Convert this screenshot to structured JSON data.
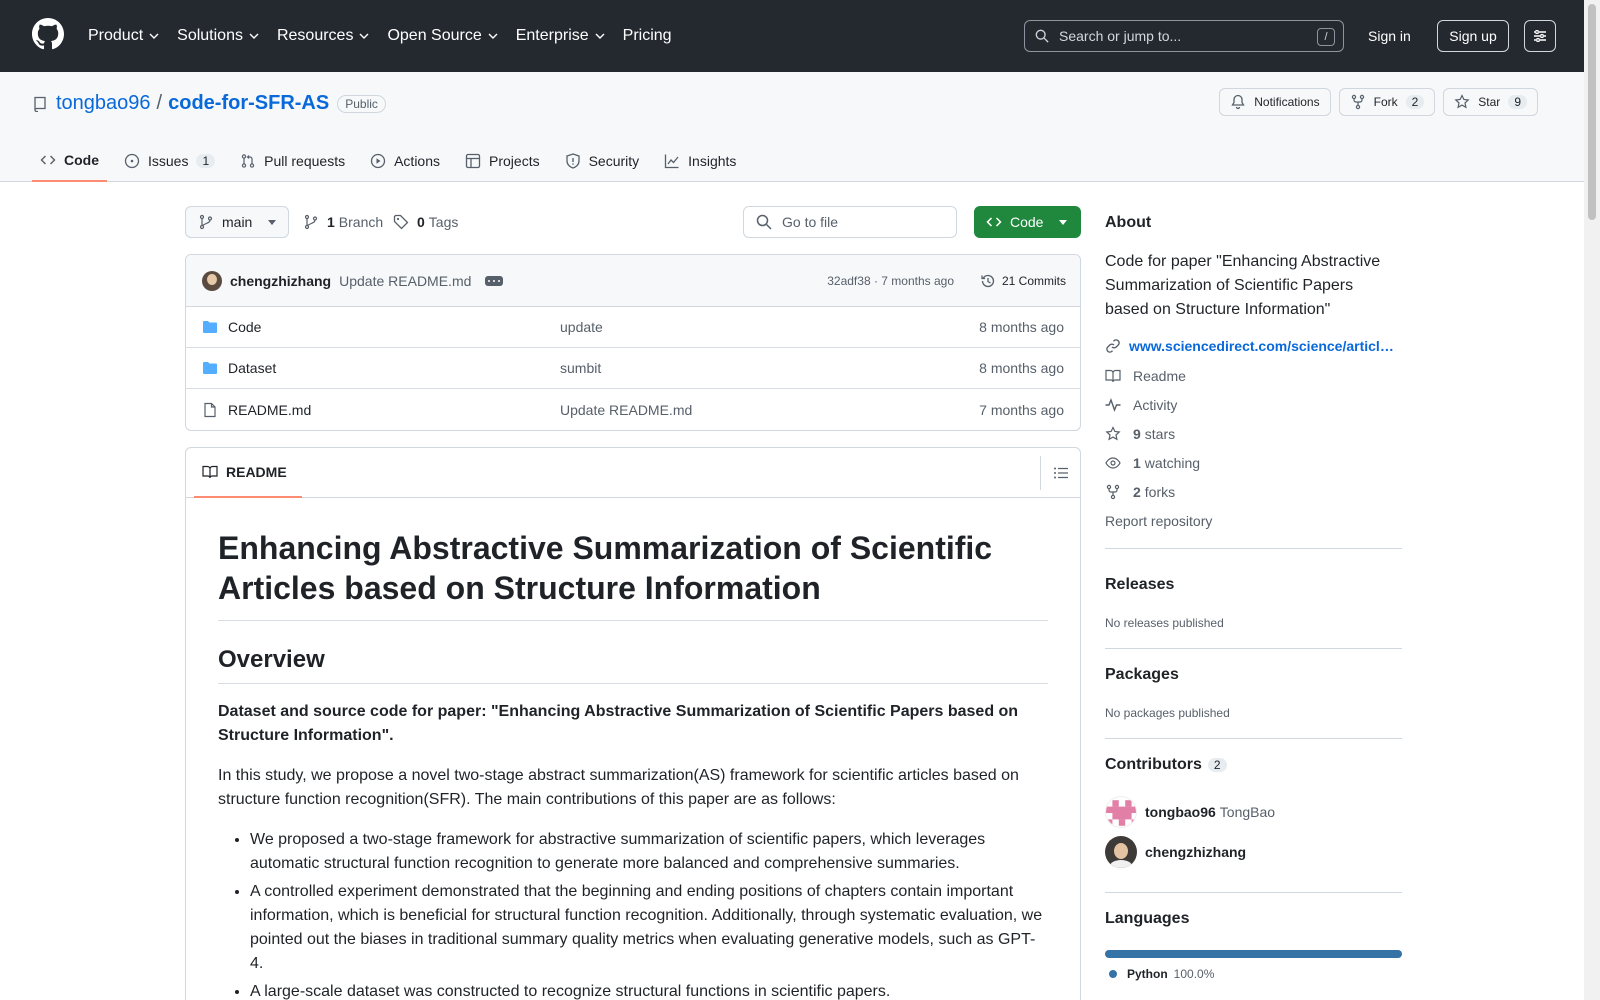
{
  "nav": {
    "items": [
      {
        "label": "Product",
        "has_menu": true
      },
      {
        "label": "Solutions",
        "has_menu": true
      },
      {
        "label": "Resources",
        "has_menu": true
      },
      {
        "label": "Open Source",
        "has_menu": true
      },
      {
        "label": "Enterprise",
        "has_menu": true
      },
      {
        "label": "Pricing",
        "has_menu": false
      }
    ],
    "search_placeholder": "Search or jump to...",
    "search_shortcut": "/",
    "sign_in": "Sign in",
    "sign_up": "Sign up"
  },
  "repo": {
    "owner": "tongbao96",
    "separator": "/",
    "name": "code-for-SFR-AS",
    "visibility": "Public",
    "notifications_label": "Notifications",
    "fork_label": "Fork",
    "fork_count": "2",
    "star_label": "Star",
    "star_count": "9"
  },
  "tabs": [
    {
      "label": "Code",
      "icon": "code-icon",
      "active": true
    },
    {
      "label": "Issues",
      "icon": "issue-icon",
      "count": "1"
    },
    {
      "label": "Pull requests",
      "icon": "pull-request-icon"
    },
    {
      "label": "Actions",
      "icon": "play-icon"
    },
    {
      "label": "Projects",
      "icon": "table-icon"
    },
    {
      "label": "Security",
      "icon": "shield-icon"
    },
    {
      "label": "Insights",
      "icon": "graph-icon"
    }
  ],
  "toolbar": {
    "branch": "main",
    "branch_count": "1",
    "branch_label": "Branch",
    "tag_count": "0",
    "tag_label": "Tags",
    "go_to_file": "Go to file",
    "code_button": "Code"
  },
  "commit": {
    "author": "chengzhizhang",
    "message": "Update README.md",
    "sha_time": "32adf38 · 7 months ago",
    "commits_label": "21 Commits"
  },
  "files": [
    {
      "name": "Code",
      "type": "folder",
      "message": "update",
      "time": "8 months ago"
    },
    {
      "name": "Dataset",
      "type": "folder",
      "message": "sumbit",
      "time": "8 months ago"
    },
    {
      "name": "README.md",
      "type": "file",
      "message": "Update README.md",
      "time": "7 months ago"
    }
  ],
  "readme": {
    "tab_label": "README",
    "title": "Enhancing Abstractive Summarization of Scientific Articles based on Structure Information",
    "overview_heading": "Overview",
    "bold_intro": "Dataset and source code for paper: \"Enhancing Abstractive Summarization of Scientific Papers based on Structure Information\".",
    "intro": "In this study, we propose a novel two-stage abstract summarization(AS) framework for scientific articles based on structure function recognition(SFR). The main contributions of this paper are as follows:",
    "bullets": [
      "We proposed a two-stage framework for abstractive summarization of scientific papers, which leverages automatic structural function recognition to generate more balanced and comprehensive summaries.",
      "A controlled experiment demonstrated that the beginning and ending positions of chapters contain important information, which is beneficial for structural function recognition. Additionally, through systematic evaluation, we pointed out the biases in traditional summary quality metrics when evaluating generative models, such as GPT-4.",
      "A large-scale dataset was constructed to recognize structural functions in scientific papers."
    ]
  },
  "sidebar": {
    "about_heading": "About",
    "description": "Code for paper \"Enhancing Abstractive Summarization of Scientific Papers based on Structure Information\"",
    "link": "www.sciencedirect.com/science/articl…",
    "readme": "Readme",
    "activity": "Activity",
    "stars_count": "9",
    "stars_label": "stars",
    "watching_count": "1",
    "watching_label": "watching",
    "forks_count": "2",
    "forks_label": "forks",
    "report": "Report repository",
    "releases_heading": "Releases",
    "releases_empty": "No releases published",
    "packages_heading": "Packages",
    "packages_empty": "No packages published",
    "contributors_heading": "Contributors",
    "contributors_count": "2",
    "contributors": [
      {
        "login": "tongbao96",
        "name": "TongBao"
      },
      {
        "login": "chengzhizhang",
        "name": ""
      }
    ],
    "languages_heading": "Languages",
    "language": {
      "name": "Python",
      "percent": "100.0%",
      "color": "#3572A5"
    }
  },
  "colors": {
    "header_bg": "#24292f",
    "link": "#0969da",
    "primary_button": "#1f883d",
    "active_tab_underline": "#fd8c73"
  }
}
